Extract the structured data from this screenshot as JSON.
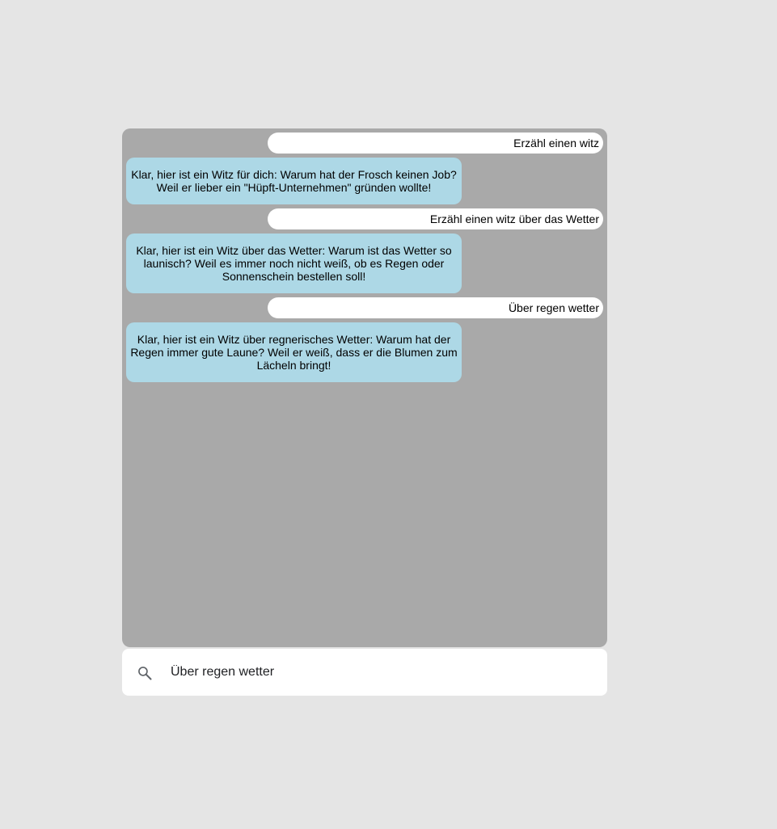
{
  "chat": {
    "messages": [
      {
        "role": "user",
        "text": "Erzähl einen witz"
      },
      {
        "role": "bot",
        "text": "Klar, hier ist ein Witz für dich: Warum hat der Frosch keinen Job? Weil er lieber ein \"Hüpft-Unternehmen\" gründen wollte!"
      },
      {
        "role": "user",
        "text": "Erzähl einen witz über das Wetter"
      },
      {
        "role": "bot",
        "text": "Klar, hier ist ein Witz über das Wetter: Warum ist das Wetter so launisch? Weil es immer noch nicht weiß, ob es Regen oder Sonnenschein bestellen soll!"
      },
      {
        "role": "user",
        "text": "Über regen wetter"
      },
      {
        "role": "bot",
        "text": "Klar, hier ist ein Witz über regnerisches Wetter: Warum hat der Regen immer gute Laune? Weil er weiß, dass er die Blumen zum Lächeln bringt!"
      }
    ]
  },
  "search": {
    "value": "Über regen wetter",
    "icon": "search-icon"
  },
  "colors": {
    "page_background": "#e5e5e5",
    "chat_background": "#a9a9a9",
    "user_bubble": "#ffffff",
    "bot_bubble": "#add8e6"
  }
}
